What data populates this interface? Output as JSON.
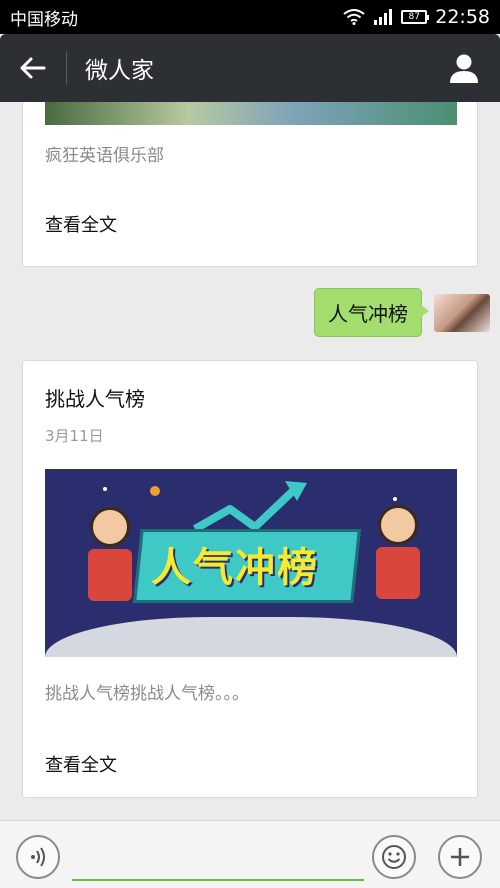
{
  "status_bar": {
    "carrier": "中国移动",
    "battery": "87",
    "time": "22:58"
  },
  "header": {
    "title": "微人家",
    "back_icon": "arrow-left-icon",
    "profile_icon": "person-icon"
  },
  "messages": [
    {
      "type": "article",
      "description": "疯狂英语俱乐部",
      "read_more": "查看全文"
    },
    {
      "type": "text",
      "from": "self",
      "text": "人气冲榜"
    },
    {
      "type": "article",
      "title": "挑战人气榜",
      "date": "3月11日",
      "banner_text": "人气冲榜",
      "description": "挑战人气榜挑战人气榜。。。",
      "read_more": "查看全文"
    }
  ],
  "input_bar": {
    "voice_icon": "voice-icon",
    "emoji_icon": "emoji-icon",
    "plus_icon": "plus-icon",
    "value": ""
  },
  "colors": {
    "header_bg": "#2c3035",
    "bubble_green": "#a3dd6e",
    "input_underline": "#64b93a"
  }
}
